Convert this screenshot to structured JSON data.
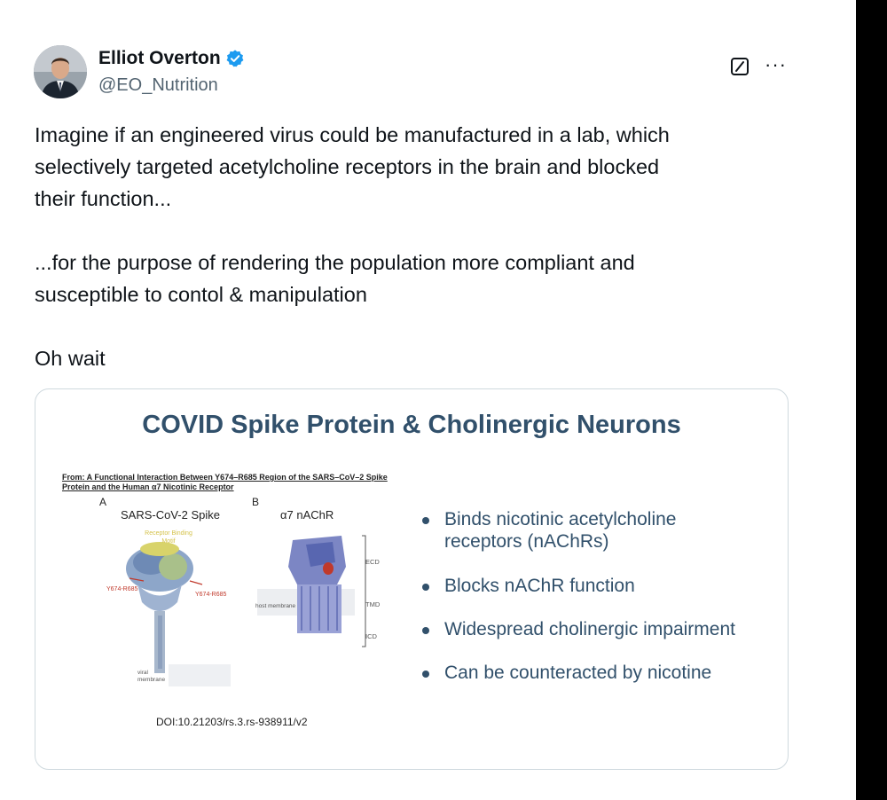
{
  "author": {
    "name": "Elliot Overton",
    "handle": "@EO_Nutrition",
    "verified": true,
    "verified_icon": "verified-badge-icon",
    "verified_color": "#1d9bf0"
  },
  "actions": {
    "grok_icon": "grok-icon",
    "more_icon": "more-icon",
    "more_label": "···"
  },
  "tweet": {
    "paragraphs": [
      "Imagine if an engineered virus could be manufactured in a lab, which\nselectively targeted acetylcholine receptors in the brain and blocked\ntheir function...",
      "...for the purpose of rendering the population more compliant and\nsusceptible to contol & manipulation",
      "Oh wait"
    ]
  },
  "slide": {
    "title": "COVID Spike Protein & Cholinergic Neurons",
    "title_color": "#31506b",
    "citation": "From: A Functional Interaction Between Y674–R685 Region of the SARS–CoV–2 Spike\nProtein and the Human α7 Nicotinic Receptor",
    "panel_a": {
      "letter": "A",
      "title": "SARS-CoV-2 Spike",
      "rbm_label": "Receptor Binding\nMotif",
      "region_left": "Y674-R685",
      "region_right": "Y674-R685",
      "membrane": "viral\nmembrane"
    },
    "panel_b": {
      "letter": "B",
      "title": "α7 nAChR",
      "host_membrane": "host membrane",
      "ecd": "ECD",
      "tmd": "TMD",
      "icd": "ICD"
    },
    "doi": "DOI:10.21203/rs.3.rs-938911/v2",
    "bullets": [
      "Binds nicotinic acetylcholine\nreceptors (nAChRs)",
      "Blocks nAChR function",
      "Widespread cholinergic impairment",
      "Can be counteracted by nicotine"
    ]
  }
}
